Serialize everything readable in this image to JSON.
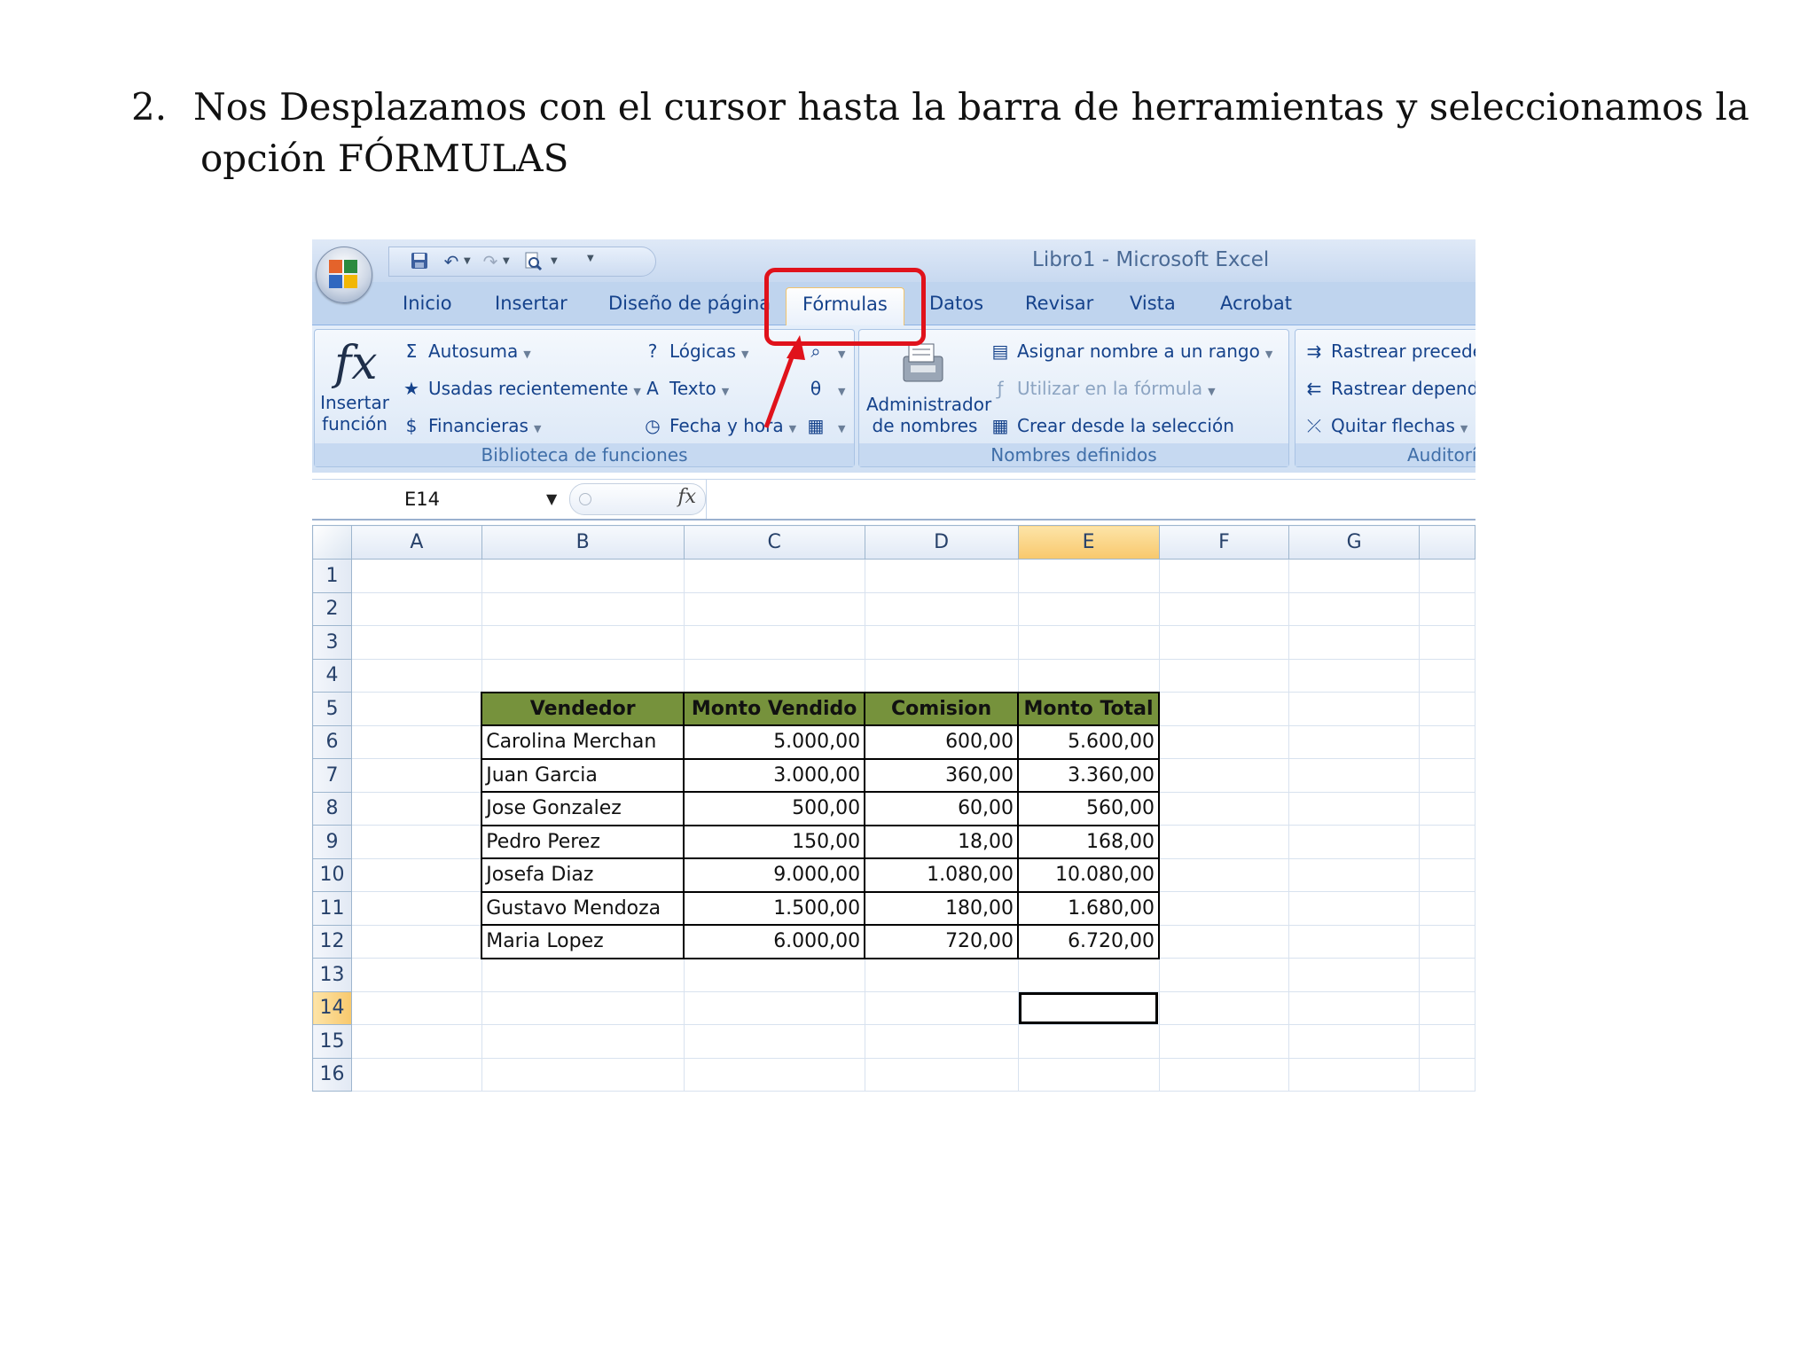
{
  "slide": {
    "number": "2.",
    "line1": "Nos Desplazamos con el cursor hasta la barra de herramientas y seleccionamos la",
    "line2": "opción FÓRMULAS"
  },
  "window": {
    "title": "Libro1  -  Microsoft Excel"
  },
  "qat": {
    "icons": [
      "save-icon",
      "undo-icon",
      "redo-icon",
      "print-preview-icon",
      "customize-icon"
    ]
  },
  "tabs": [
    "Inicio",
    "Insertar",
    "Diseño de página",
    "Fórmulas",
    "Datos",
    "Revisar",
    "Vista",
    "Acrobat"
  ],
  "active_tab": "Fórmulas",
  "ribbon": {
    "biblioteca": {
      "label": "Biblioteca de funciones",
      "insert_function": "Insertar función",
      "insert_line1": "Insertar",
      "insert_line2": "función",
      "autosuma": "Autosuma",
      "usadas": "Usadas recientemente",
      "financieras": "Financieras",
      "logicas": "Lógicas",
      "texto": "Texto",
      "fecha": "Fecha y hora"
    },
    "nombres": {
      "label": "Nombres definidos",
      "admin_line1": "Administrador",
      "admin_line2": "de nombres",
      "asignar": "Asignar nombre a un rango",
      "utilizar": "Utilizar en la fórmula",
      "crear": "Crear desde la selección"
    },
    "auditoria": {
      "label": "Auditorí",
      "rastrear_prec": "Rastrear precede",
      "rastrear_dep": "Rastrear depend",
      "quitar": "Quitar flechas"
    }
  },
  "formula_bar": {
    "name_box": "E14",
    "fx": "fx",
    "content": ""
  },
  "sheet": {
    "columns": [
      "A",
      "B",
      "C",
      "D",
      "E",
      "F",
      "G"
    ],
    "selected_column": "E",
    "selected_row": "14",
    "rows": [
      "1",
      "2",
      "3",
      "4",
      "5",
      "6",
      "7",
      "8",
      "9",
      "10",
      "11",
      "12",
      "13",
      "14",
      "15",
      "16"
    ],
    "table_header": [
      "Vendedor",
      "Monto Vendido",
      "Comision",
      "Monto Total"
    ],
    "table_rows": [
      [
        "Carolina Merchan",
        "5.000,00",
        "600,00",
        "5.600,00"
      ],
      [
        "Juan Garcia",
        "3.000,00",
        "360,00",
        "3.360,00"
      ],
      [
        "Jose Gonzalez",
        "500,00",
        "60,00",
        "560,00"
      ],
      [
        "Pedro Perez",
        "150,00",
        "18,00",
        "168,00"
      ],
      [
        "Josefa Diaz",
        "9.000,00",
        "1.080,00",
        "10.080,00"
      ],
      [
        "Gustavo Mendoza",
        "1.500,00",
        "180,00",
        "1.680,00"
      ],
      [
        "Maria Lopez",
        "6.000,00",
        "720,00",
        "6.720,00"
      ]
    ],
    "header_color": "#76923c"
  },
  "colors": {
    "highlight": "#e0121b",
    "ribbon_text": "#15428b"
  }
}
